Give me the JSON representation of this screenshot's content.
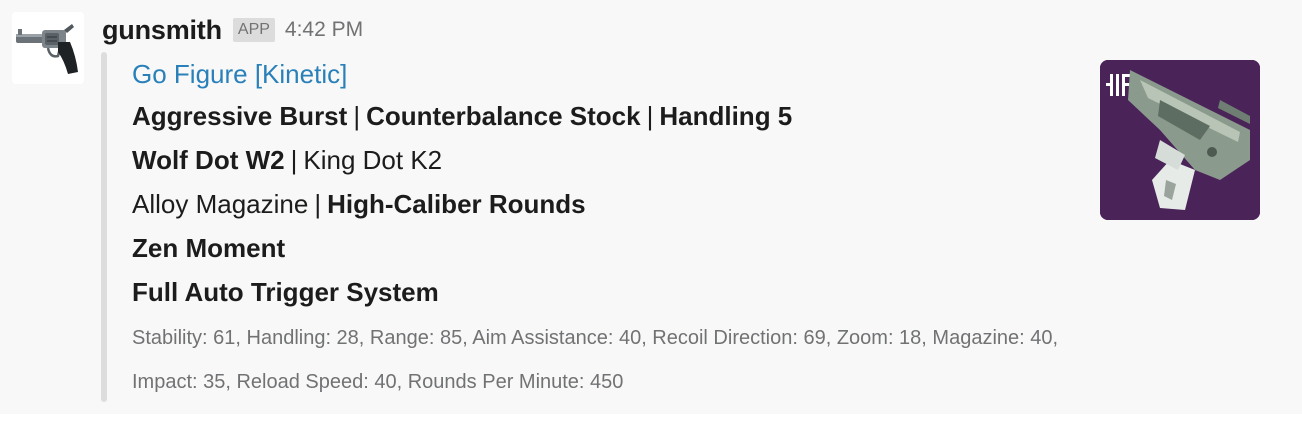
{
  "message": {
    "avatar_icon": "revolver-icon",
    "username": "gunsmith",
    "badge": "APP",
    "timestamp": "4:42 PM"
  },
  "attachment": {
    "title": "Go Figure [Kinetic]",
    "perk_rows": [
      {
        "a": "Aggressive Burst",
        "b": "Counterbalance Stock",
        "c": "Handling 5"
      },
      {
        "a": "Wolf Dot W2",
        "b": "King Dot K2"
      },
      {
        "a": "Alloy Magazine",
        "b": "High-Caliber Rounds"
      },
      {
        "a": "Zen Moment"
      },
      {
        "a": "Full Auto Trigger System"
      }
    ],
    "separator": "|",
    "stats": "Stability: 61, Handling: 28, Range: 85, Aim Assistance: 40, Recoil Direction: 69, Zoom: 18, Magazine: 40, Impact: 35, Reload Speed: 40, Rounds Per Minute: 450",
    "thumbnail_icon": "weapon-thumbnail",
    "colors": {
      "link": "#2a80b9",
      "thumbnail_bg": "#4a2358",
      "bar": "#dddddd"
    }
  }
}
